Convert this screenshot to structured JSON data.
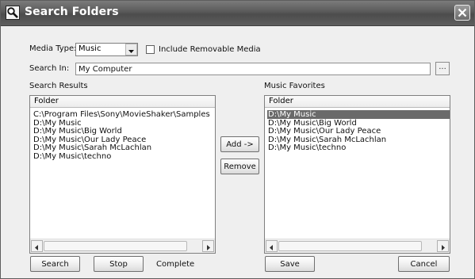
{
  "window": {
    "title": "Search Folders",
    "title_icon": "search-folder-icon",
    "close_icon": "close-icon"
  },
  "media_type": {
    "label": "Media Type:",
    "selected": "Music"
  },
  "removable": {
    "label": "Include Removable Media",
    "checked": false
  },
  "search_in": {
    "label": "Search In:",
    "value": "My Computer",
    "browse_label": "..."
  },
  "search_results": {
    "label": "Search Results",
    "column": "Folder",
    "items": [
      "C:\\Program Files\\Sony\\MovieShaker\\Samples",
      "D:\\My Music",
      "D:\\My Music\\Big World",
      "D:\\My Music\\Our Lady Peace",
      "D:\\My Music\\Sarah McLachlan",
      "D:\\My Music\\techno"
    ]
  },
  "favorites": {
    "label": "Music Favorites",
    "column": "Folder",
    "items": [
      "D:\\My Music",
      "D:\\My Music\\Big World",
      "D:\\My Music\\Our Lady Peace",
      "D:\\My Music\\Sarah McLachlan",
      "D:\\My Music\\techno"
    ],
    "selected_index": 0
  },
  "buttons": {
    "add": "Add ->",
    "remove": "Remove",
    "search": "Search",
    "stop": "Stop",
    "save": "Save",
    "cancel": "Cancel"
  },
  "status": "Complete",
  "colors": {
    "titlebar": "#595959",
    "selection": "#6a6a6a",
    "dialog_bg": "#efefef"
  }
}
